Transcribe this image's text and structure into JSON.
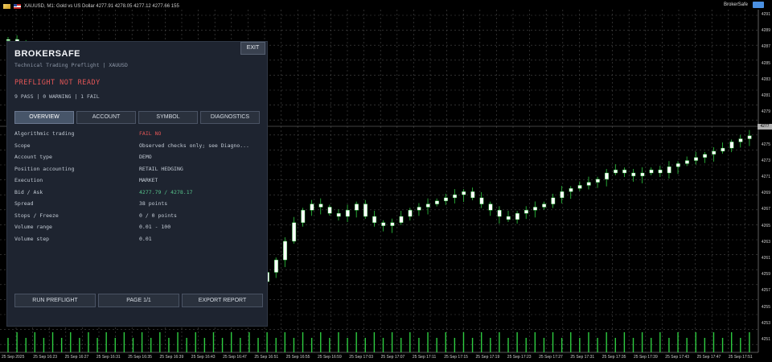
{
  "chart": {
    "title_text": "XAUUSD, M1: Gold vs US Dollar  4277.91  4278.05  4277.12  4277.66  155",
    "ea_name": "BrokerSafe",
    "current_price_label": "4277",
    "y_ticks": [
      "4291",
      "4289",
      "4287",
      "4285",
      "4283",
      "4281",
      "4279",
      "4277",
      "4275",
      "4273",
      "4271",
      "4269",
      "4267",
      "4265",
      "4263",
      "4261",
      "4259",
      "4257",
      "4255",
      "4253",
      "4251"
    ],
    "x_ticks": [
      "25 Sep 2025",
      "25 Sep 16:23",
      "25 Sep 16:27",
      "25 Sep 16:31",
      "25 Sep 16:35",
      "25 Sep 16:39",
      "25 Sep 16:43",
      "25 Sep 16:47",
      "25 Sep 16:51",
      "25 Sep 16:55",
      "25 Sep 16:59",
      "25 Sep 17:03",
      "25 Sep 17:07",
      "25 Sep 17:11",
      "25 Sep 17:15",
      "25 Sep 17:19",
      "25 Sep 17:23",
      "25 Sep 17:27",
      "25 Sep 17:31",
      "25 Sep 17:35",
      "25 Sep 17:39",
      "25 Sep 17:43",
      "25 Sep 17:47",
      "25 Sep 17:51"
    ],
    "colors": {
      "bull": "#ffffff",
      "bear": "#ffffff",
      "wick": "#2ecc40",
      "grid": "#4a4a4a",
      "volume": "#2ecc40"
    }
  },
  "panel": {
    "brand": "BROKERSAFE",
    "subtitle": "Technical Trading Preflight | XAUUSD",
    "status": "PREFLIGHT  NOT READY",
    "summary": "9 PASS | 0 WARNING | 1 FAIL",
    "exit_label": "EXIT",
    "tabs": [
      {
        "label": "OVERVIEW",
        "active": true
      },
      {
        "label": "ACCOUNT",
        "active": false
      },
      {
        "label": "SYMBOL",
        "active": false
      },
      {
        "label": "DIAGNOSTICS",
        "active": false
      }
    ],
    "rows": [
      {
        "label": "Algorithmic trading",
        "value": "FAIL  NO"
      },
      {
        "label": "Scope",
        "value": "Observed checks only; see Diagno..."
      },
      {
        "label": "Account type",
        "value": "DEMO"
      },
      {
        "label": "Position accounting",
        "value": "RETAIL HEDGING"
      },
      {
        "label": "Execution",
        "value": "MARKET"
      },
      {
        "label": "Bid / Ask",
        "value": "4277.79 / 4278.17"
      },
      {
        "label": "Spread",
        "value": "38 points"
      },
      {
        "label": "Stops / Freeze",
        "value": "0 / 0 points"
      },
      {
        "label": "Volume range",
        "value": "0.01 - 100"
      },
      {
        "label": "Volume step",
        "value": "0.01"
      }
    ],
    "footer": {
      "run_label": "RUN PREFLIGHT",
      "page_label": "PAGE 1/1",
      "export_label": "EXPORT REPORT"
    },
    "colors": {
      "fail": "#e25656",
      "bidask": "#56c08a",
      "background": "#1e2430"
    }
  }
}
